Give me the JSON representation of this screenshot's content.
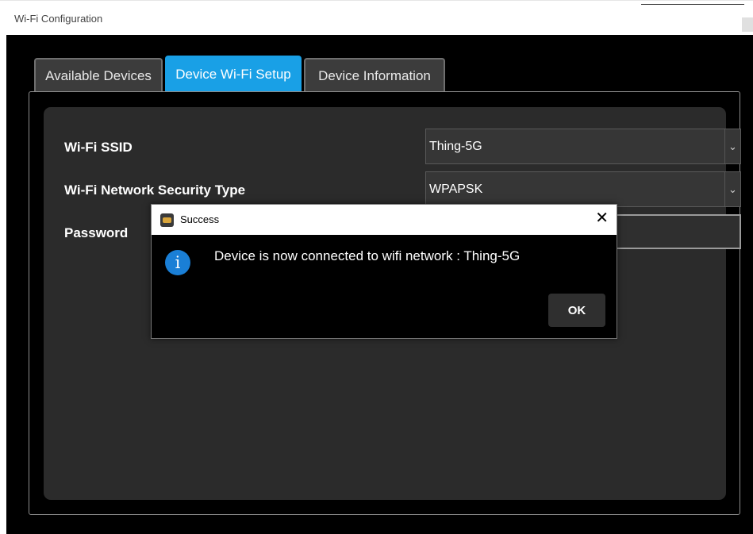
{
  "window": {
    "title": "Wi-Fi Configuration"
  },
  "tabs": [
    {
      "label": "Available Devices",
      "active": false
    },
    {
      "label": "Device Wi-Fi Setup",
      "active": true
    },
    {
      "label": "Device Information",
      "active": false
    }
  ],
  "form": {
    "ssid_label": "Wi-Fi SSID",
    "ssid_value": "Thing-5G",
    "security_label": "Wi-Fi Network Security Type",
    "security_value": "WPAPSK",
    "password_label": "Password",
    "password_value": ""
  },
  "dialog": {
    "title": "Success",
    "message": "Device is now connected to wifi network : Thing-5G",
    "ok_label": "OK",
    "info_icon_glyph": "i",
    "close_glyph": "✕"
  },
  "colors": {
    "active_tab": "#19a0e6",
    "background": "#000000",
    "panel": "#2b2b2b",
    "info_icon": "#1a7fd6"
  }
}
